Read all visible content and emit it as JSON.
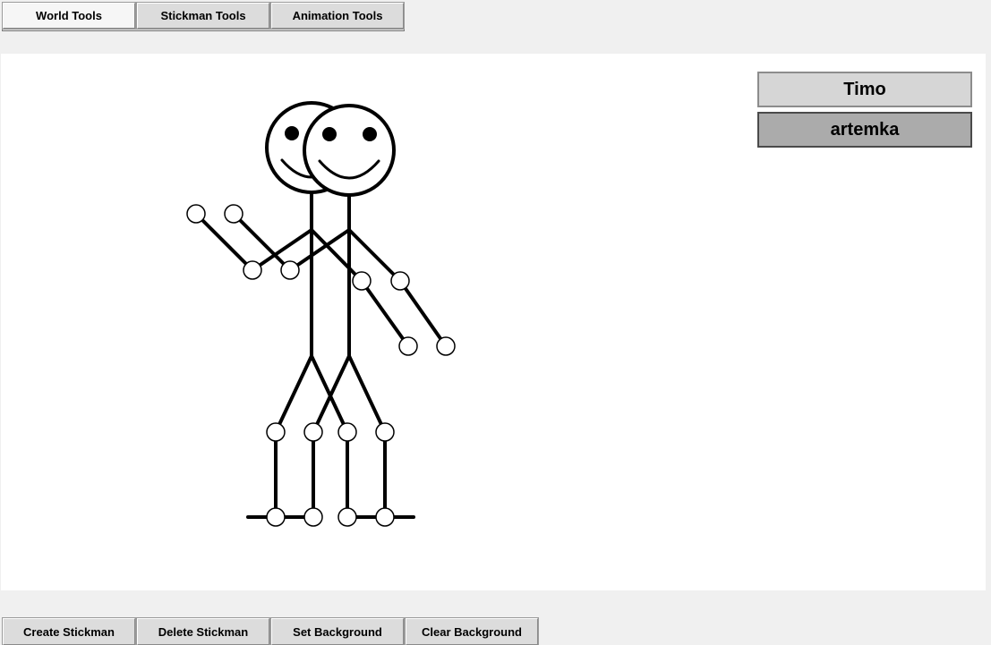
{
  "tabs": [
    {
      "label": "World Tools",
      "active": true
    },
    {
      "label": "Stickman Tools",
      "active": false
    },
    {
      "label": "Animation Tools",
      "active": false
    }
  ],
  "stickmen": [
    {
      "name": "Timo",
      "selected": false
    },
    {
      "name": "artemka",
      "selected": true
    }
  ],
  "toolbar": {
    "create_label": "Create Stickman",
    "delete_label": "Delete Stickman",
    "set_bg_label": "Set Background",
    "clear_bg_label": "Clear Background"
  },
  "colors": {
    "canvas_bg": "#ffffff",
    "window_bg": "#f0f0f0",
    "selected_item": "#ababab",
    "unselected_item": "#d6d6d6",
    "stroke": "#000000"
  }
}
